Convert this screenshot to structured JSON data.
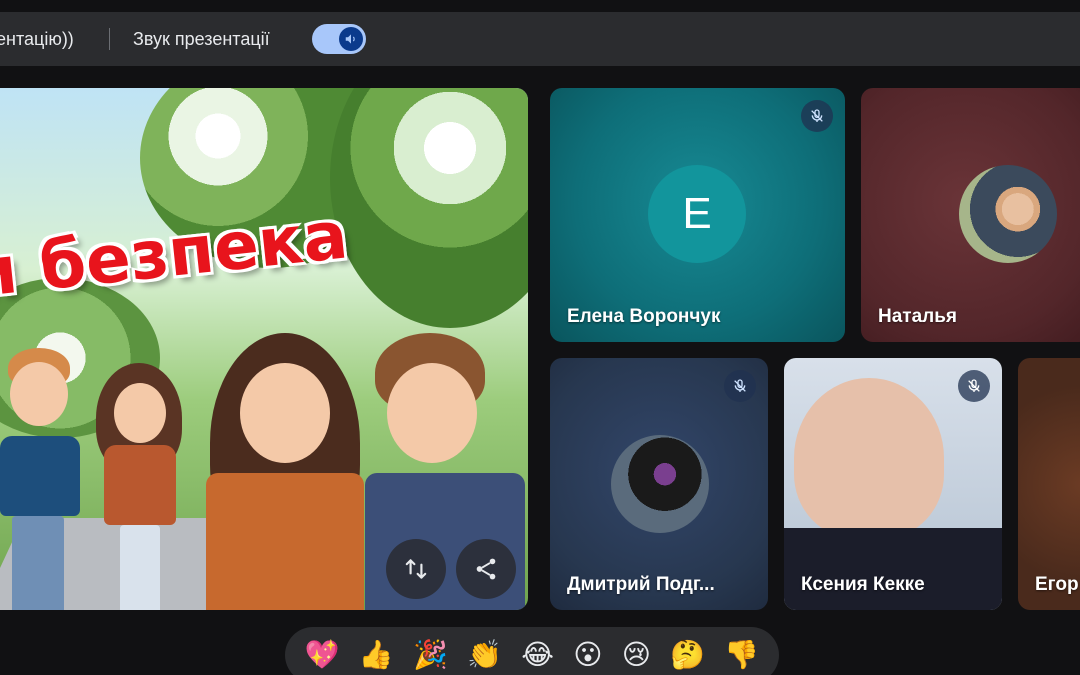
{
  "topbar": {
    "presentation_text": "ентацію))",
    "sound_label": "Звук презентації",
    "sound_toggle_on": true
  },
  "slide": {
    "title_text": "и безпека"
  },
  "participants": [
    {
      "name": "Елена Ворончук",
      "initial": "Е",
      "muted": true,
      "bg": "#0e6e78"
    },
    {
      "name": "Наталья",
      "muted": false,
      "bg": "#5a2a2e"
    },
    {
      "name": "Дмитрий Подг...",
      "muted": true,
      "bg": "#27374f"
    },
    {
      "name": "Ксения Кекке",
      "muted": true,
      "bg": "#c8d4e4"
    },
    {
      "name": "Егор",
      "muted": false,
      "bg": "#4a2a1c"
    }
  ],
  "reactions": [
    "💖",
    "👍",
    "🎉",
    "👏",
    "😂",
    "😮",
    "😢",
    "🤔",
    "👎"
  ],
  "colors": {
    "accent": "#a8c7fa",
    "toggle_knob": "#0b3a8c",
    "surface": "#2b2c2f",
    "background": "#111113"
  }
}
